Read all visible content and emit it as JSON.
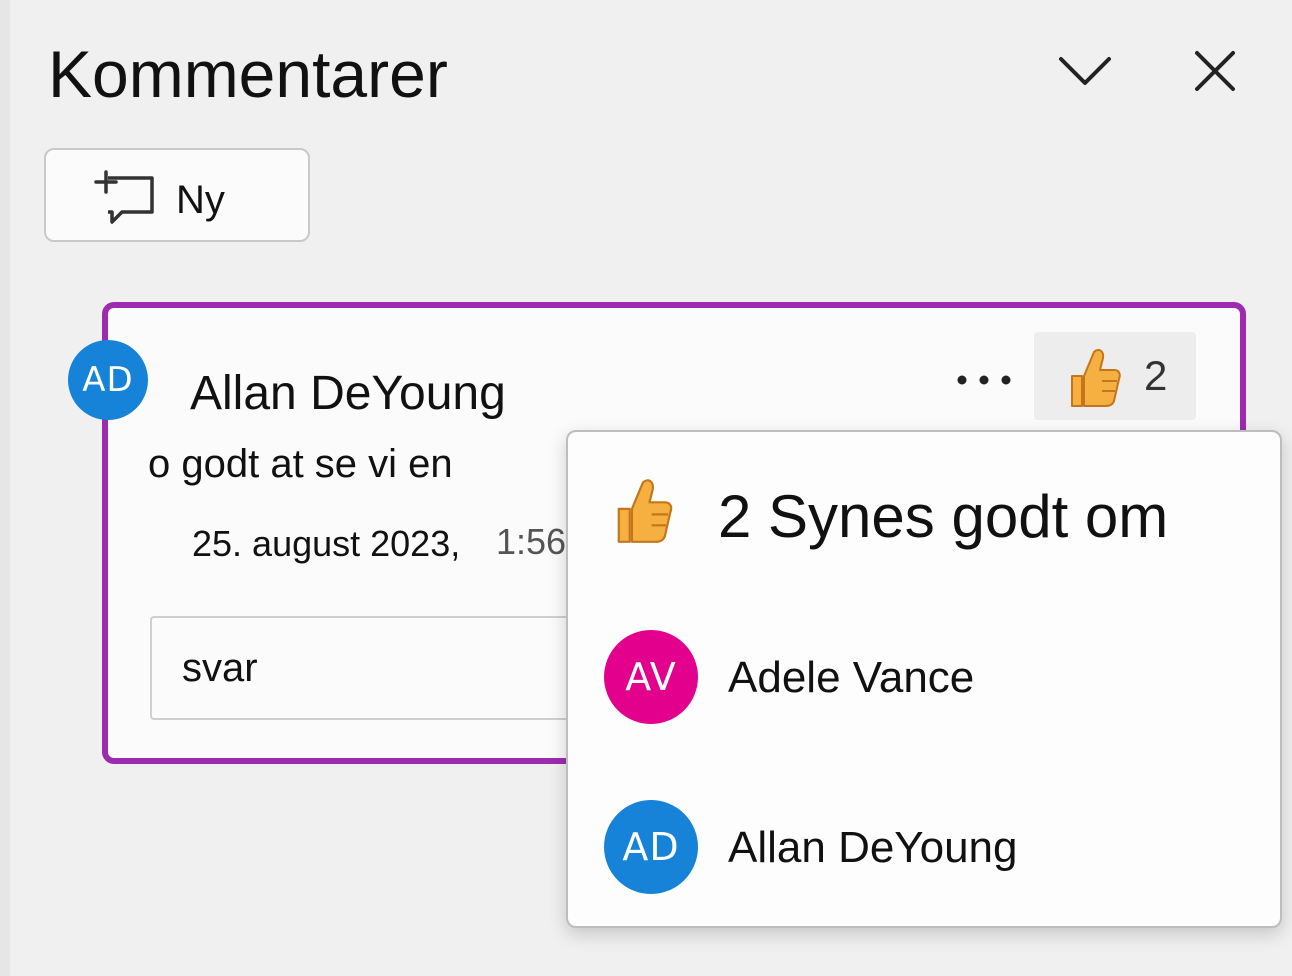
{
  "panel": {
    "title": "Kommentarer"
  },
  "toolbar": {
    "new_label": "Ny"
  },
  "comment": {
    "author_initials": "AD",
    "author_name": "Allan DeYoung",
    "text": "o godt at se vi en",
    "date": "25. august 2023,",
    "time": "1:56",
    "like_count": "2",
    "reply_placeholder": "svar"
  },
  "likes_popup": {
    "heading": "2 Synes godt om",
    "people": [
      {
        "initials": "AV",
        "name": "Adele Vance",
        "color": "#e3008c"
      },
      {
        "initials": "AD",
        "name": "Allan DeYoung",
        "color": "#1683d8"
      }
    ]
  },
  "colors": {
    "accent_border": "#9c2bb0",
    "thumb_fill": "#f5b041"
  }
}
